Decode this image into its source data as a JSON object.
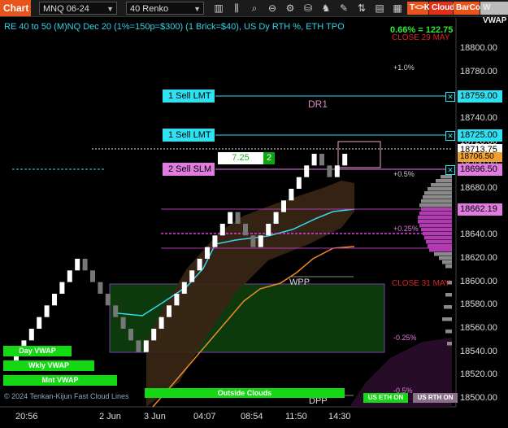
{
  "toolbar": {
    "chart_tab": "Chart",
    "instrument": "MNQ 06-24",
    "bar_type": "40 Renko",
    "tags": {
      "tk": "T<>K",
      "cloud": "Cloud",
      "barcol": "BarCol",
      "vwap": "W VWAP"
    }
  },
  "header": {
    "title": "RE 40 to 50 (M)NQ Dec 20 (1%=150p=$300) (1 Brick=$40), US Dy RTH %, ETH TPO",
    "pct_change": "0.66% = 122.75",
    "close_label_1": "CLOSE 29 MAY",
    "close_label_2": "CLOSE 31 MAY"
  },
  "levels": {
    "p1": "+1.0%",
    "p05": "+0.5%",
    "p025": "+0.25%",
    "m025": "-0.25%",
    "m05": "-0.5%",
    "dr1": "DR1",
    "wpp": "WPP",
    "dpp": "DPP"
  },
  "orders": [
    {
      "label": "1 Sell LMT",
      "price": "18759.00"
    },
    {
      "label": "1 Sell LMT",
      "price": "18725.00"
    },
    {
      "label": "2 Sell SLM",
      "price": "18696.50"
    }
  ],
  "ticket": {
    "value": "7.25",
    "qty": "2"
  },
  "price_boxes": {
    "last": "18713.75",
    "cross": "18706.50",
    "vp": "18662.19"
  },
  "y_axis": [
    "18800.00",
    "18780.00",
    "18760.00",
    "18740.00",
    "18720.00",
    "18700.00",
    "18680.00",
    "18660.00",
    "18640.00",
    "18620.00",
    "18600.00",
    "18580.00",
    "18560.00",
    "18540.00",
    "18520.00",
    "18500.00"
  ],
  "x_axis": [
    "20:56",
    "2 Jun",
    "3 Jun",
    "04:07",
    "08:54",
    "11:50",
    "14:30"
  ],
  "bottom_labels": {
    "day_vwap": "Day VWAP",
    "wkly_vwap": "Wkly VWAP",
    "mnt_vwap": "Mnt VWAP",
    "footer": "© 2024 Tenkan-Kijun Fast Cloud Lines",
    "outside_clouds": "Outside Clouds",
    "us_eth": "US ETH ON",
    "us_rth": "US RTH ON"
  },
  "colors": {
    "bull": "#ffffff",
    "bear": "#777777",
    "cyan": "#2ee0f0",
    "magenta": "#e07be0",
    "kijun": "#f08a28",
    "tenkan": "#38d8f0",
    "box": "#0d3a0d"
  },
  "chart_data": {
    "type": "renko",
    "bricks_close": [
      18540,
      18550,
      18560,
      18570,
      18580,
      18590,
      18600,
      18610,
      18620,
      18610,
      18600,
      18590,
      18580,
      18570,
      18560,
      18550,
      18540,
      18550,
      18560,
      18570,
      18580,
      18590,
      18600,
      18610,
      18620,
      18630,
      18640,
      18650,
      18660,
      18650,
      18640,
      18630,
      18640,
      18650,
      18660,
      18670,
      18680,
      18690,
      18700,
      18710,
      18700,
      18690,
      18700,
      18710
    ]
  }
}
